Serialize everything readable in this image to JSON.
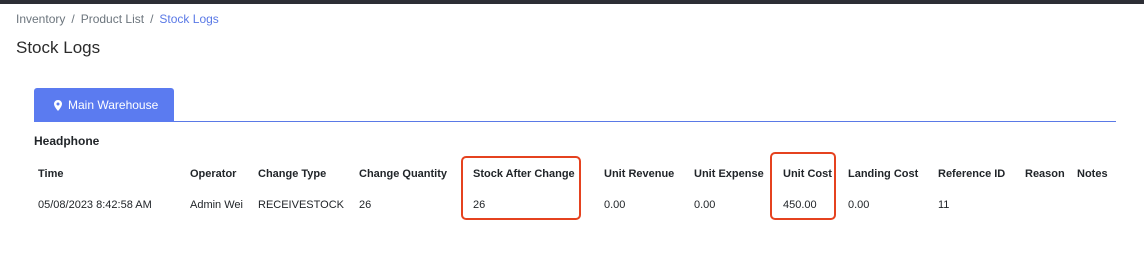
{
  "breadcrumb": [
    {
      "label": "Inventory"
    },
    {
      "label": "Product List"
    },
    {
      "label": "Stock Logs"
    }
  ],
  "breadcrumb_separator": "/",
  "page": {
    "title": "Stock Logs"
  },
  "tabs": [
    {
      "label": "Main Warehouse",
      "icon": "location-pin-icon",
      "active": true
    }
  ],
  "product": {
    "name": "Headphone"
  },
  "table": {
    "columns": [
      "Time",
      "Operator",
      "Change Type",
      "Change Quantity",
      "Stock After Change",
      "Unit Revenue",
      "Unit Expense",
      "Unit Cost",
      "Landing Cost",
      "Reference ID",
      "Reason",
      "Notes"
    ],
    "rows": [
      [
        "05/08/2023 8:42:58 AM",
        "Admin Wei",
        "RECEIVESTOCK",
        "26",
        "26",
        "0.00",
        "0.00",
        "450.00",
        "0.00",
        "11",
        "",
        ""
      ]
    ]
  },
  "colors": {
    "accent": "#5b7bf0",
    "highlight": "#e5421f",
    "topbar": "#2d2f36"
  }
}
